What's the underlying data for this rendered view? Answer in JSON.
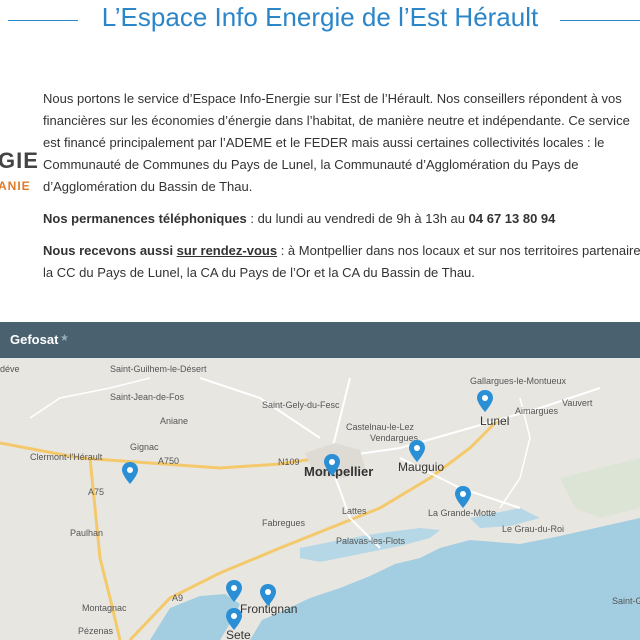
{
  "header": {
    "title": "L’Espace Info Energie de l’Est Hérault"
  },
  "logo": {
    "line1": "GIE",
    "line2": "ANIE"
  },
  "intro": {
    "lines": [
      "Nous portons le service d’Espace Info-Energie sur l’Est de l’Hérault. Nos conseillers répondent à vos",
      "financières sur les économies d’énergie dans l’habitat, de manière neutre et indépendante. Ce service",
      "est financé principalement par l’ADEME et le FEDER mais aussi certaines collectivités locales : le",
      "Communauté de Communes du Pays de Lunel, la Communauté d’Agglomération du Pays de",
      "d’Agglomération du Bassin de Thau."
    ]
  },
  "phone": {
    "label": "Nos permanences téléphoniques",
    "hours": " : du lundi au vendredi de 9h à 13h au ",
    "number": "04 67 13 80 94"
  },
  "rdv": {
    "label_prefix": "Nous recevons aussi ",
    "label_link": "sur rendez-vous",
    "text_line1": " : à Montpellier dans nos locaux et sur nos territoires partenaires",
    "text_line2": "la CC du Pays de Lunel, la CA du Pays de l’Or et la CA du Bassin de Thau."
  },
  "map": {
    "toolbar_label": "Gefosat",
    "toolbar_icon": "star-icon",
    "colors": {
      "sea": "#a3cde0",
      "land": "#e8e6e1",
      "pin": "#2b8fd6",
      "road": "#ffffff",
      "highway": "#f4c96b"
    },
    "places": {
      "saint_guilhem": "Saint-Guilhem-le-Désert",
      "saint_jean": "Saint-Jean-de-Fos",
      "aniane": "Aniane",
      "gignac": "Gignac",
      "clermont": "Clermont-l'Hérault",
      "a750": "A750",
      "a75": "A75",
      "paulhan": "Paulhan",
      "montagnac": "Montagnac",
      "pezenas": "Pézenas",
      "a9": "A9",
      "lodeve": "déve",
      "saint_gely": "Saint-Gely-du-Fesc",
      "castelnau": "Castelnau-le-Lez",
      "n109": "N109",
      "montpellier": "Montpellier",
      "vendargues": "Vendargues",
      "mauguio": "Mauguio",
      "lattes": "Lattes",
      "fabregues": "Fabregues",
      "palavas": "Palavas-les-Flots",
      "frontignan": "Frontignan",
      "sete": "Sete",
      "gallargues": "Gallargues-le-Montueux",
      "aimargues": "Aimargues",
      "vauvert": "Vauvert",
      "lunel": "Lunel",
      "grande_motte": "La Grande-Motte",
      "grau_du_roi": "Le Grau-du-Roi",
      "saint_g": "Saint-G"
    }
  }
}
